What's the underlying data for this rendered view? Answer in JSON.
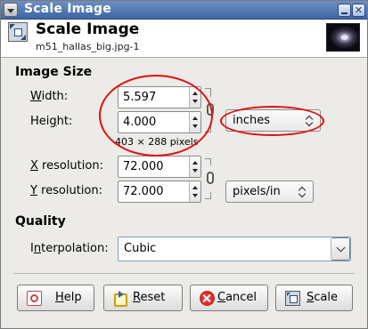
{
  "window": {
    "title": "Scale Image"
  },
  "header": {
    "title": "Scale Image",
    "subtitle": "m51_hallas_big.jpg-1"
  },
  "image_size": {
    "section_title": "Image Size",
    "width_label": "Width:",
    "width_mnemonic": "W",
    "width_rest": "idth:",
    "width_value": "5.597",
    "height_label": "Height:",
    "height_pre": "Hei",
    "height_mnemonic": "g",
    "height_rest": "ht:",
    "height_value": "4.000",
    "unit": "inches",
    "pixel_info": "403 × 288 pixels"
  },
  "resolution": {
    "x_mnemonic": "X",
    "x_rest": " resolution:",
    "x_value": "72.000",
    "y_mnemonic": "Y",
    "y_rest": " resolution:",
    "y_value": "72.000",
    "unit": "pixels/in"
  },
  "quality": {
    "section_title": "Quality",
    "interp_pre": "I",
    "interp_mnemonic": "n",
    "interp_rest": "terpolation:",
    "interpolation": "Cubic"
  },
  "buttons": {
    "help_mnemonic": "H",
    "help_rest": "elp",
    "reset_mnemonic": "R",
    "reset_rest": "eset",
    "cancel_mnemonic": "C",
    "cancel_rest": "ancel",
    "scale_mnemonic": "S",
    "scale_rest": "cale"
  },
  "annotation_color": "#e01010"
}
